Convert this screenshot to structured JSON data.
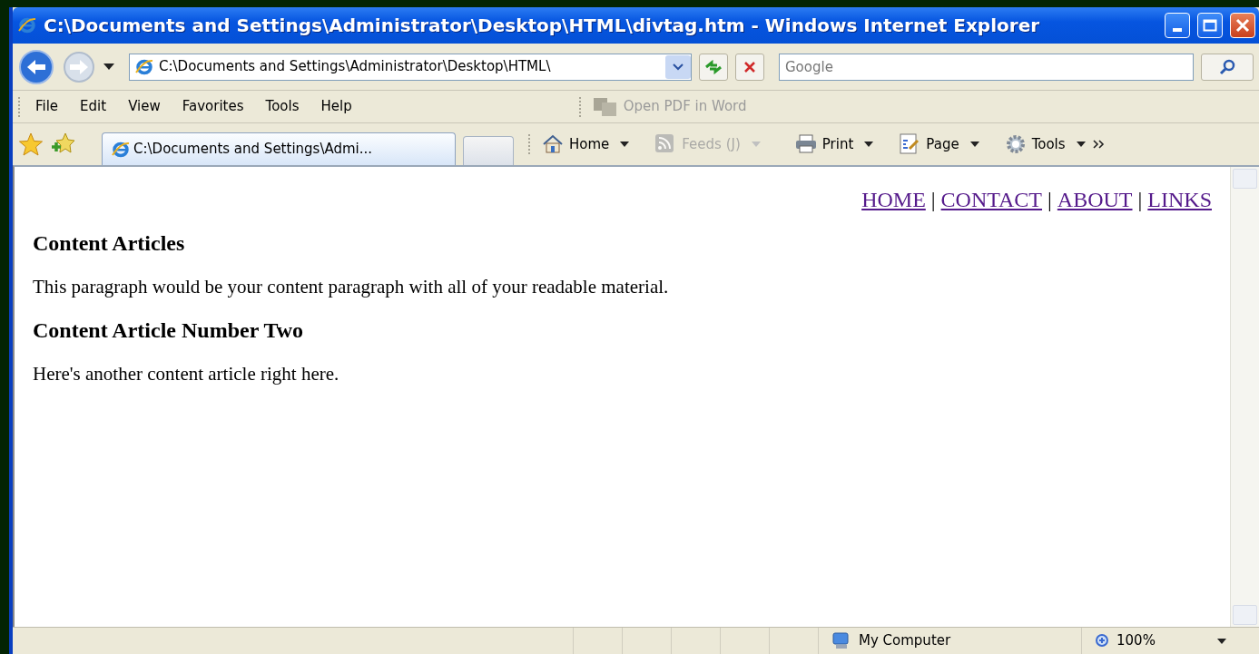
{
  "window": {
    "title": "C:\\Documents and Settings\\Administrator\\Desktop\\HTML\\divtag.htm - Windows Internet Explorer"
  },
  "navigation": {
    "address": "C:\\Documents and Settings\\Administrator\\Desktop\\HTML\\",
    "search_placeholder": "Google"
  },
  "menu": [
    "File",
    "Edit",
    "View",
    "Favorites",
    "Tools",
    "Help"
  ],
  "addon_toolbar": {
    "label": "Open PDF in Word",
    "disabled": true
  },
  "tabs": [
    {
      "label": "C:\\Documents and Settings\\Admi...",
      "selected": true
    }
  ],
  "command_bar": [
    {
      "kind": "home",
      "label": "Home",
      "disabled": false
    },
    {
      "kind": "feeds",
      "label": "Feeds (J)",
      "disabled": true
    },
    {
      "kind": "print",
      "label": "Print",
      "disabled": false
    },
    {
      "kind": "page",
      "label": "Page",
      "disabled": false
    },
    {
      "kind": "tools",
      "label": "Tools",
      "disabled": false
    }
  ],
  "page": {
    "nav": [
      {
        "kind": "link",
        "text": "HOME"
      },
      {
        "kind": "separator",
        "text": "|"
      },
      {
        "kind": "link",
        "text": "CONTACT"
      },
      {
        "kind": "separator",
        "text": "|"
      },
      {
        "kind": "link",
        "text": "ABOUT"
      },
      {
        "kind": "separator",
        "text": "|"
      },
      {
        "kind": "link",
        "text": "LINKS"
      }
    ],
    "articles": [
      {
        "heading": "Content Articles",
        "paragraph": "This paragraph would be your content paragraph with all of your readable material."
      },
      {
        "heading": "Content Article Number Two",
        "paragraph": "Here's another content article right here."
      }
    ]
  },
  "status_bar": {
    "zone": "My Computer",
    "zoom": "100%"
  }
}
